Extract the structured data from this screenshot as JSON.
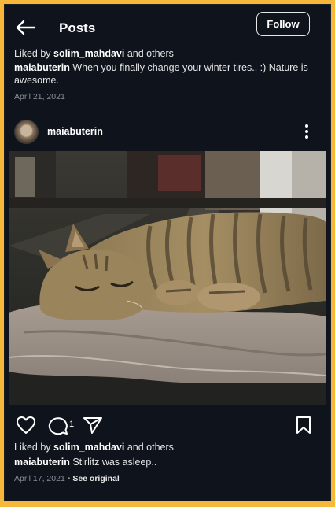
{
  "header": {
    "title": "Posts",
    "follow_label": "Follow"
  },
  "previous_post": {
    "liked_prefix": "Liked by ",
    "liked_user": "solim_mahdavi",
    "liked_suffix": " and others",
    "caption_user": "maiabuterin",
    "caption_text": " When you finally change your winter tires.. :) Nature is awesome.",
    "date": "April 21, 2021"
  },
  "post": {
    "username": "maiabuterin",
    "comment_count": "1",
    "liked_prefix": "Liked by ",
    "liked_user": "solim_mahdavi",
    "liked_suffix": " and others",
    "caption_user": "maiabuterin",
    "caption_text": " Stirlitz was asleep..",
    "date": "April 17, 2021",
    "separator": " • ",
    "see_original": "See original"
  },
  "icons": {
    "back": "arrow-left",
    "more": "vertical-dots",
    "like": "heart-outline",
    "comment": "speech-bubble-outline",
    "share": "paper-plane-outline",
    "save": "bookmark-outline"
  },
  "colors": {
    "background": "#0e131c",
    "outer_frame": "#f5b83a",
    "muted_text": "#8c8f96"
  }
}
